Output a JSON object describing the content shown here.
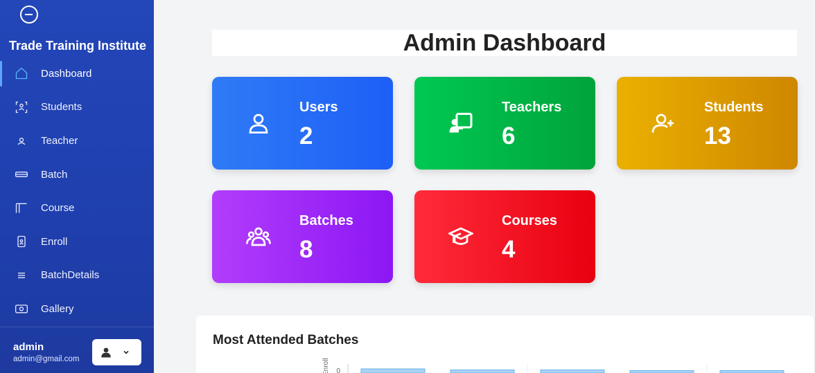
{
  "sidebar": {
    "brand": "Trade Training Institute",
    "items": [
      {
        "label": "Dashboard",
        "icon": "home-icon",
        "active": true
      },
      {
        "label": "Students",
        "icon": "users-bracket-icon"
      },
      {
        "label": "Teacher",
        "icon": "person-icon"
      },
      {
        "label": "Batch",
        "icon": "card-icon"
      },
      {
        "label": "Course",
        "icon": "layout-icon"
      },
      {
        "label": "Enroll",
        "icon": "id-badge-icon"
      },
      {
        "label": "BatchDetails",
        "icon": "list-icon"
      },
      {
        "label": "Gallery",
        "icon": "camera-icon"
      }
    ],
    "user": {
      "name": "admin",
      "email": "admin@gmail.com"
    }
  },
  "main": {
    "title": "Admin Dashboard",
    "cards": [
      {
        "label": "Users",
        "value": "2",
        "icon": "user-icon",
        "color_from": "#2f7bf6",
        "color_to": "#1d5ff7"
      },
      {
        "label": "Teachers",
        "value": "6",
        "icon": "chalkboard-teacher-icon",
        "color_from": "#00c853",
        "color_to": "#00a43a"
      },
      {
        "label": "Students",
        "value": "13",
        "icon": "user-plus-icon",
        "color_from": "#eab000",
        "color_to": "#cf8700"
      },
      {
        "label": "Batches",
        "value": "8",
        "icon": "group-icon",
        "color_from": "#b23dfb",
        "color_to": "#8c17f4"
      },
      {
        "label": "Courses",
        "value": "4",
        "icon": "graduation-cap-icon",
        "color_from": "#ff2b3b",
        "color_to": "#e8000f"
      }
    ],
    "chart_section": {
      "title": "Most Attended Batches"
    }
  },
  "chart_data": {
    "type": "bar",
    "title": "Most Attended Batches",
    "ylabel": "Enroll",
    "yticks": [
      "0"
    ],
    "bar_color": "#aad4f5",
    "bar_border": "#6ab2ea"
  }
}
